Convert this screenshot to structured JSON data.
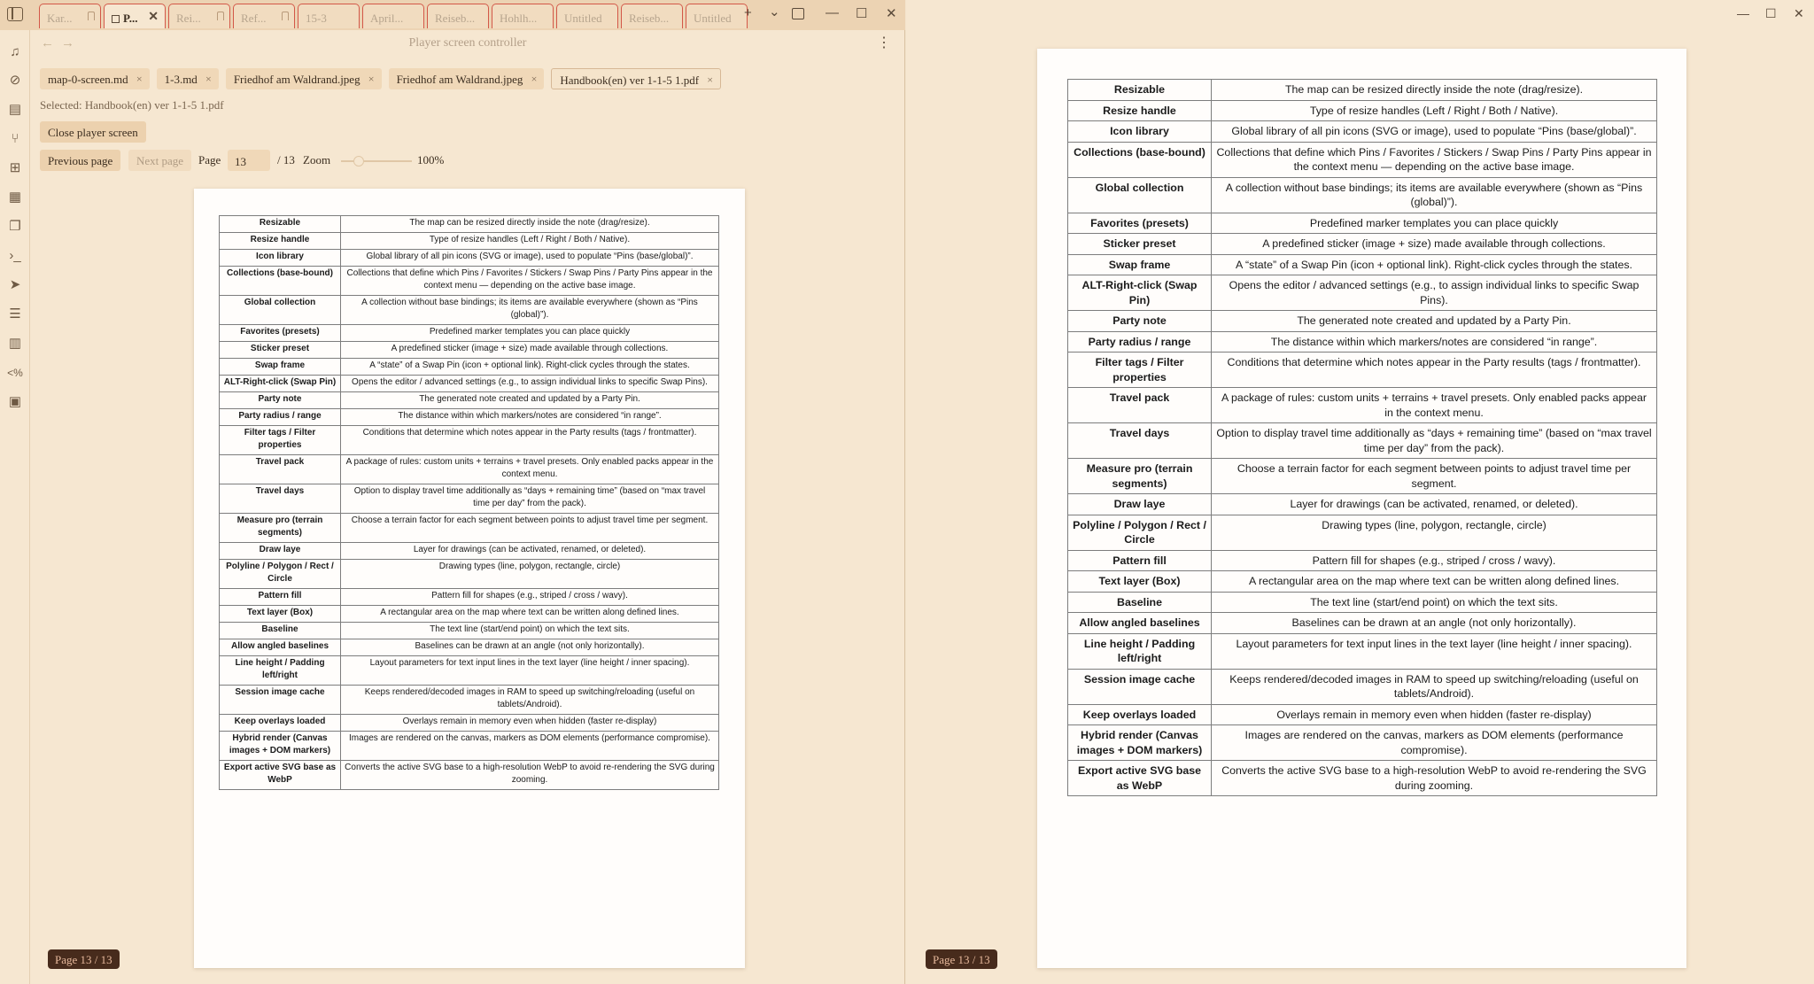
{
  "tabs": [
    {
      "label": "Kar...",
      "pinned": true
    },
    {
      "label": "P...",
      "active": true
    },
    {
      "label": "Rei...",
      "pinned": true
    },
    {
      "label": "Ref...",
      "pinned": true
    },
    {
      "label": "15-3"
    },
    {
      "label": "April..."
    },
    {
      "label": "Reiseb..."
    },
    {
      "label": "Hohlh..."
    },
    {
      "label": "Untitled"
    },
    {
      "label": "Reiseb..."
    },
    {
      "label": "Untitled"
    }
  ],
  "icons": {
    "new_tab": "+",
    "tab_list": "⌄",
    "minimize": "—",
    "maximize": "☐",
    "close": "✕",
    "back": "←",
    "forward": "→",
    "more": "⋮",
    "tab_close": "✕",
    "chip_close": "×"
  },
  "ribbon_icons": [
    "music-icon",
    "eye-off-icon",
    "file-text-icon",
    "branch-icon",
    "grid-icon",
    "calendar-icon",
    "copy-icon",
    "terminal-icon",
    "send-icon",
    "list-icon",
    "table-icon",
    "percent-code-icon",
    "calendar-check-icon"
  ],
  "view": {
    "title": "Player screen controller",
    "files": [
      {
        "name": "map-0-screen.md"
      },
      {
        "name": "1-3.md"
      },
      {
        "name": "Friedhof am Waldrand.jpeg"
      },
      {
        "name": "Friedhof am Waldrand.jpeg"
      },
      {
        "name": "Handbook(en) ver 1-1-5 1.pdf",
        "active": true
      }
    ],
    "selected": "Selected: Handbook(en) ver 1-1-5 1.pdf",
    "close_button": "Close player screen",
    "prev_button": "Previous page",
    "next_button": "Next page",
    "page_label": "Page",
    "page_value": "13",
    "page_total": "/ 13",
    "zoom_label": "Zoom",
    "zoom_value": "100%",
    "zoom_fraction": 0.25,
    "page_badge": "Page 13 / 13"
  },
  "right": {
    "page_badge": "Page 13 / 13"
  },
  "table_rows": [
    {
      "term": "Resizable",
      "desc": "The map can be resized directly inside the note (drag/resize)."
    },
    {
      "term": "Resize handle",
      "desc": "Type of resize handles (Left / Right / Both / Native)."
    },
    {
      "term": "Icon library",
      "desc": "Global library of all pin icons (SVG or image), used to populate “Pins (base/global)”."
    },
    {
      "term": "Collections (base-bound)",
      "desc": "Collections that define which Pins / Favorites / Stickers / Swap Pins / Party Pins appear in the context menu — depending on the active base image."
    },
    {
      "term": "Global collection",
      "desc": "A collection without base bindings; its items are available everywhere (shown as “Pins (global)”)."
    },
    {
      "term": "Favorites (presets)",
      "desc": "Predefined marker templates you can place quickly"
    },
    {
      "term": "Sticker preset",
      "desc": "A predefined sticker (image + size) made available through collections."
    },
    {
      "term": "Swap frame",
      "desc": "A “state” of a Swap Pin (icon + optional link). Right-click cycles through the states."
    },
    {
      "term": "ALT-Right-click (Swap Pin)",
      "desc": "Opens the editor / advanced settings (e.g., to assign individual links to specific Swap Pins)."
    },
    {
      "term": "Party note",
      "desc": "The generated note created and updated by a Party Pin."
    },
    {
      "term": "Party radius / range",
      "desc": "The distance within which markers/notes are considered “in range”."
    },
    {
      "term": "Filter tags / Filter properties",
      "desc": "Conditions that determine which notes appear in the Party results (tags / frontmatter)."
    },
    {
      "term": "Travel pack",
      "desc": "A package of rules: custom units + terrains + travel presets. Only enabled packs appear in the context menu."
    },
    {
      "term": "Travel days",
      "desc": "Option to display travel time additionally as “days + remaining time” (based on “max travel time per day” from the pack)."
    },
    {
      "term": "Measure pro (terrain segments)",
      "desc": "Choose a terrain factor for each segment between points to adjust travel time per segment."
    },
    {
      "term": "Draw laye",
      "desc": "Layer for drawings (can be activated, renamed, or deleted)."
    },
    {
      "term": "Polyline / Polygon / Rect / Circle",
      "desc": "Drawing types (line, polygon, rectangle, circle)"
    },
    {
      "term": "Pattern fill",
      "desc": "Pattern fill for shapes (e.g., striped / cross / wavy)."
    },
    {
      "term": "Text layer (Box)",
      "desc": "A rectangular area on the map where text can be written along defined lines."
    },
    {
      "term": "Baseline",
      "desc": "The text line (start/end point) on which the text sits."
    },
    {
      "term": "Allow angled baselines",
      "desc": "Baselines can be drawn at an angle (not only horizontally)."
    },
    {
      "term": "Line height / Padding left/right",
      "desc": "Layout parameters for text input lines in the text layer (line height / inner spacing)."
    },
    {
      "term": "Session image cache",
      "desc": "Keeps rendered/decoded images in RAM to speed up switching/reloading (useful on tablets/Android)."
    },
    {
      "term": "Keep overlays loaded",
      "desc": "Overlays remain in memory even when hidden (faster re-display)"
    },
    {
      "term": "Hybrid render (Canvas images + DOM markers)",
      "desc": "Images are rendered on the canvas, markers as DOM elements (performance compromise)."
    },
    {
      "term": "Export active SVG base as WebP",
      "desc": "Converts the active SVG base to a high-resolution WebP to avoid re-rendering the SVG during zooming."
    }
  ]
}
